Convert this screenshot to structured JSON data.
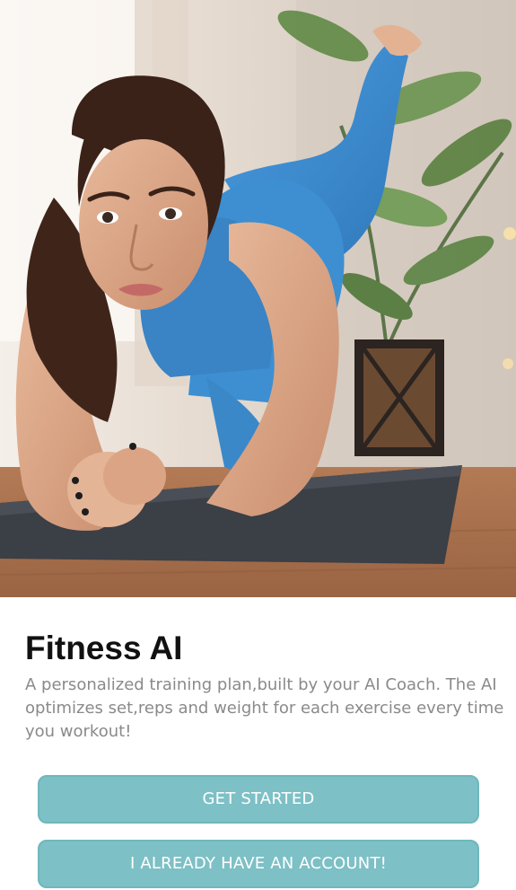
{
  "hero": {
    "image_subject": "woman doing plank exercise on yoga mat"
  },
  "app": {
    "title": "Fitness AI",
    "description": "A personalized training plan,built by your AI Coach. The AI optimizes set,reps and weight for each exercise every time you workout!"
  },
  "actions": {
    "get_started_label": "GET STARTED",
    "login_label": "I ALREADY HAVE AN ACCOUNT!"
  },
  "colors": {
    "button_fill": "#7dc0c6",
    "button_border": "#6fb7bd",
    "button_text": "#ffffff",
    "title_text": "#111111",
    "description_text": "#8a8a8a",
    "outfit_blue": "#3d8fd1"
  }
}
